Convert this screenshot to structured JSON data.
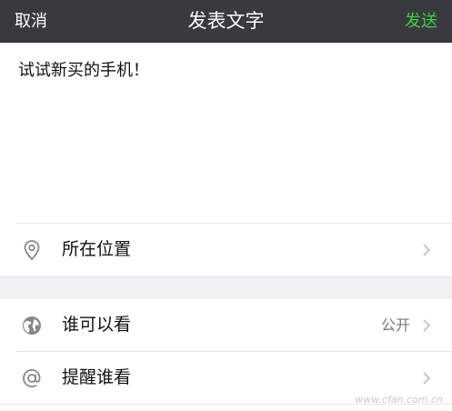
{
  "header": {
    "cancel_label": "取消",
    "title": "发表文字",
    "send_label": "发送",
    "send_color": "#3dd13d",
    "background": "#393a3f"
  },
  "compose": {
    "text": "试试新买的手机！"
  },
  "rows": {
    "location": {
      "label": "所在位置",
      "icon": "location-pin-icon"
    },
    "visibility": {
      "label": "谁可以看",
      "value": "公开",
      "icon": "globe-icon"
    },
    "mention": {
      "label": "提醒谁看",
      "icon": "at-sign-icon"
    }
  },
  "watermark": "www.cfan.com.cn"
}
